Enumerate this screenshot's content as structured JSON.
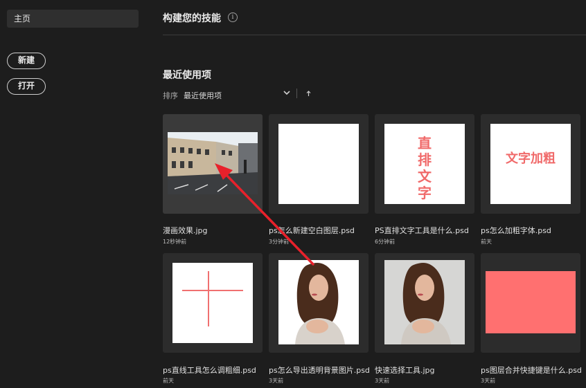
{
  "sidebar": {
    "home_label": "主页",
    "new_label": "新建",
    "open_label": "打开"
  },
  "header": {
    "title": "构建您的技能",
    "info_glyph": "i"
  },
  "recent": {
    "title": "最近使用项",
    "sort_label": "排序",
    "sort_value": "最近使用项"
  },
  "files": [
    {
      "name": "漫画效果.jpg",
      "time": "12秒钟前"
    },
    {
      "name": "ps怎么新建空白图层.psd",
      "time": "3分钟前"
    },
    {
      "name": "PS直排文字工具是什么.psd",
      "time": "6分钟前"
    },
    {
      "name": "ps怎么加粗字体.psd",
      "time": "前天"
    },
    {
      "name": "ps直线工具怎么调粗细.psd",
      "time": "前天"
    },
    {
      "name": "ps怎么导出透明背景图片.psd",
      "time": "3天前"
    },
    {
      "name": "快速选择工具.jpg",
      "time": "3天前"
    },
    {
      "name": "ps图层合并快捷键是什么.psd",
      "time": "3天前"
    }
  ],
  "thumb_text": {
    "vertical": "直排文字",
    "bold": "文字加粗"
  },
  "colors": {
    "accent_red": "#ff7070",
    "annotation_arrow": "#e8212b"
  },
  "icons": {
    "info": "info-icon",
    "sort_dropdown": "chevron-down-icon",
    "sort_direction": "arrow-up-icon"
  }
}
